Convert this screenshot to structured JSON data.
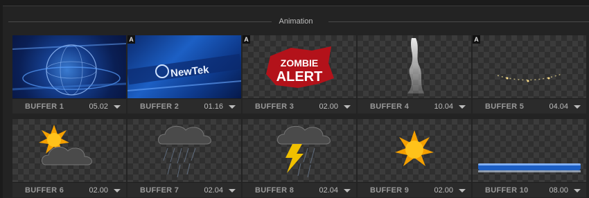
{
  "panel": {
    "title": "Animation"
  },
  "tiles": [
    {
      "name": "BUFFER 1",
      "duration": "05.02",
      "badge": ""
    },
    {
      "name": "BUFFER 2",
      "duration": "01.16",
      "badge": "A",
      "logo_text": "NewTek"
    },
    {
      "name": "BUFFER 3",
      "duration": "02.00",
      "badge": "A",
      "graphic_line1": "ZOMBIE",
      "graphic_line2": "ALERT"
    },
    {
      "name": "BUFFER 4",
      "duration": "10.04",
      "badge": ""
    },
    {
      "name": "BUFFER 5",
      "duration": "04.04",
      "badge": "A"
    },
    {
      "name": "BUFFER 6",
      "duration": "02.00",
      "badge": ""
    },
    {
      "name": "BUFFER 7",
      "duration": "02.04",
      "badge": ""
    },
    {
      "name": "BUFFER 8",
      "duration": "02.04",
      "badge": ""
    },
    {
      "name": "BUFFER 9",
      "duration": "02.00",
      "badge": ""
    },
    {
      "name": "BUFFER 10",
      "duration": "08.00",
      "badge": ""
    }
  ],
  "icons": {
    "dropdown": "chevron-down-icon",
    "tile_graphics": [
      "globe-graphic",
      "newtek-logo-graphic",
      "zombie-alert-graphic",
      "smoke-graphic",
      "sparkle-trail-graphic",
      "sun-cloud-icon",
      "rain-cloud-icon",
      "thunderstorm-icon",
      "sun-icon",
      "lower-third-bar-graphic"
    ]
  },
  "colors": {
    "background": "#232323",
    "footer": "#2b2b2b",
    "accent_blue": "#1c5fc4",
    "sun": "#f5a000"
  }
}
